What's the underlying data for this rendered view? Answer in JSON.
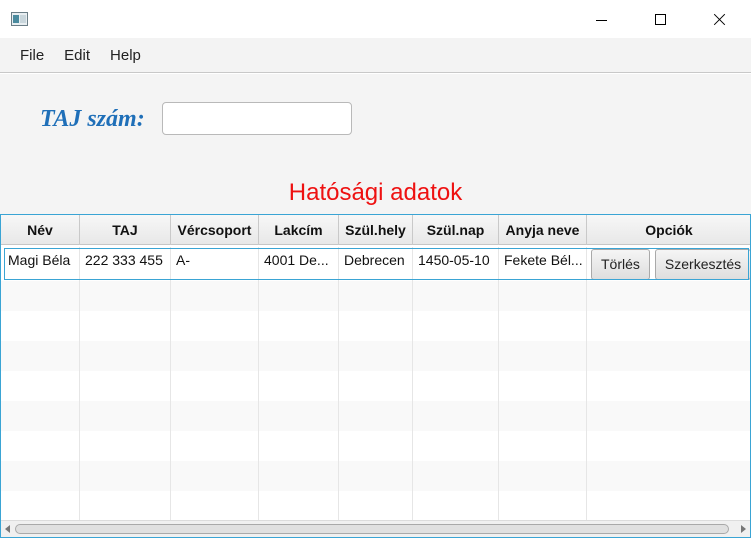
{
  "window": {
    "icon": "app-window-icon",
    "controls": {
      "minimize": "minimize-icon",
      "maximize": "maximize-icon",
      "close": "close-icon"
    }
  },
  "menu": {
    "items": [
      "File",
      "Edit",
      "Help"
    ]
  },
  "form": {
    "taj_label": "TAJ szám:",
    "taj_value": "",
    "taj_placeholder": ""
  },
  "section": {
    "title": "Hatósági adatok",
    "title_color": "#ee1111",
    "label_color": "#1f6fb8"
  },
  "table": {
    "columns": [
      "Név",
      "TAJ",
      "Vércsoport",
      "Lakcím",
      "Szül.hely",
      "Szül.nap",
      "Anyja neve",
      "Opciók"
    ],
    "rows": [
      {
        "name": "Magi Béla",
        "taj": "222 333 455",
        "blood_type": "A-",
        "address": "4001 De...",
        "birth_place": "Debrecen",
        "birth_date": "1450-05-10",
        "mother_name": "Fekete Bél...",
        "delete_label": "Törlés",
        "edit_label": "Szerkesztés"
      }
    ],
    "accent_color": "#3aa4d4"
  }
}
